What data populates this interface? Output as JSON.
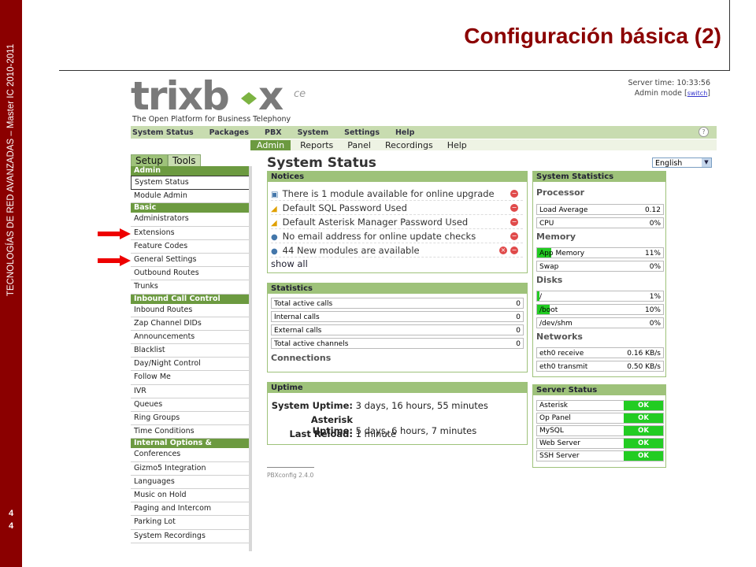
{
  "slide": {
    "title": "Configuración básica (2)",
    "side_text": "TECNOLOGÍAS DE RED AVANZADAS – Master IC 2010-2011",
    "page_numbers": [
      "4",
      "4"
    ],
    "bar_color": "#8b0000"
  },
  "header": {
    "logo": "trixbox ce",
    "tagline": "The Open Platform for Business Telephony",
    "server_time": "Server time: 10:33:56",
    "admin_mode": "Admin mode [",
    "switch_label": "switch",
    "admin_mode_end": "]",
    "help_icon": "?"
  },
  "top_menu": [
    "System Status",
    "Packages",
    "PBX",
    "System",
    "Settings",
    "Help"
  ],
  "sub_menu": [
    "Admin",
    "Reports",
    "Panel",
    "Recordings",
    "Help"
  ],
  "tabs": [
    "Setup",
    "Tools"
  ],
  "nav": {
    "admin_header": "Admin",
    "admin": [
      "System Status",
      "Module Admin"
    ],
    "basic_header": "Basic",
    "basic": [
      "Administrators",
      "Extensions",
      "Feature Codes",
      "General Settings",
      "Outbound Routes",
      "Trunks"
    ],
    "inbound_header": "Inbound Call Control",
    "inbound": [
      "Inbound Routes",
      "Zap Channel DIDs",
      "Announcements",
      "Blacklist",
      "Day/Night Control",
      "Follow Me",
      "IVR",
      "Queues",
      "Ring Groups",
      "Time Conditions"
    ],
    "internal_header": "Internal Options & Configuration",
    "internal": [
      "Conferences",
      "Gizmo5 Integration",
      "Languages",
      "Music on Hold",
      "Paging and Intercom",
      "Parking Lot",
      "System Recordings"
    ]
  },
  "main": {
    "title": "System Status",
    "language": "English",
    "notices": {
      "header": "Notices",
      "items": [
        "There is 1 module available for online upgrade",
        "Default SQL Password Used",
        "Default Asterisk Manager Password Used",
        "No email address for online update checks",
        "44 New modules are available"
      ],
      "show_all": "show all"
    },
    "statistics": {
      "header": "Statistics",
      "rows": [
        {
          "label": "Total active calls",
          "value": "0"
        },
        {
          "label": "Internal calls",
          "value": "0"
        },
        {
          "label": "External calls",
          "value": "0"
        },
        {
          "label": "Total active channels",
          "value": "0"
        }
      ],
      "connections": "Connections"
    },
    "uptime": {
      "header": "Uptime",
      "system_label": "System Uptime:",
      "system_value": "3 days, 16 hours, 55 minutes",
      "asterisk_label": "Asterisk Uptime:",
      "asterisk_value": "5 days, 6 hours, 7 minutes",
      "reload_label": "Last Reload:",
      "reload_value": "1 minute"
    },
    "system_statistics": {
      "header": "System Statistics",
      "processor": "Processor",
      "load_label": "Load Average",
      "load_value": "0.12",
      "cpu_label": "CPU",
      "cpu_value": "0%",
      "memory": "Memory",
      "app_label": "App Memory",
      "app_value": "11%",
      "app_fill": 0.11,
      "swap_label": "Swap",
      "swap_value": "0%",
      "disks": "Disks",
      "disk_root_label": "/",
      "disk_root_value": "1%",
      "disk_root_fill": 0.01,
      "disk_boot_label": "/boot",
      "disk_boot_value": "10%",
      "disk_boot_fill": 0.1,
      "disk_shm_label": "/dev/shm",
      "disk_shm_value": "0%",
      "networks": "Networks",
      "rx_label": "eth0 receive",
      "rx_value": "0.16 KB/s",
      "tx_label": "eth0 transmit",
      "tx_value": "0.50 KB/s"
    },
    "server_status": {
      "header": "Server Status",
      "items": [
        {
          "label": "Asterisk",
          "status": "OK"
        },
        {
          "label": "Op Panel",
          "status": "OK"
        },
        {
          "label": "MySQL",
          "status": "OK"
        },
        {
          "label": "Web Server",
          "status": "OK"
        },
        {
          "label": "SSH Server",
          "status": "OK"
        }
      ]
    },
    "footer": "PBXconfig 2.4.0"
  }
}
